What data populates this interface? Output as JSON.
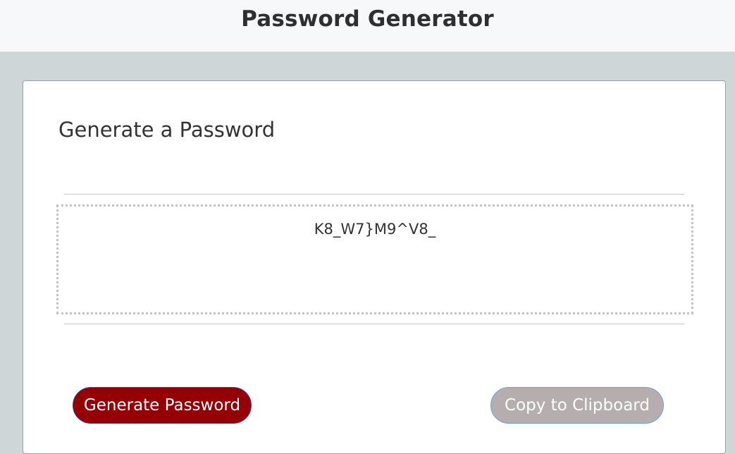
{
  "header": {
    "title": "Password Generator"
  },
  "card": {
    "title": "Generate a Password",
    "password_value": "K8_W7}M9^V8_",
    "generate_label": "Generate Password",
    "copy_label": "Copy to Clipboard"
  },
  "colors": {
    "generate_button": "#950005",
    "copy_button_disabled": "#b6aeae",
    "page_background": "#ced6d8"
  }
}
